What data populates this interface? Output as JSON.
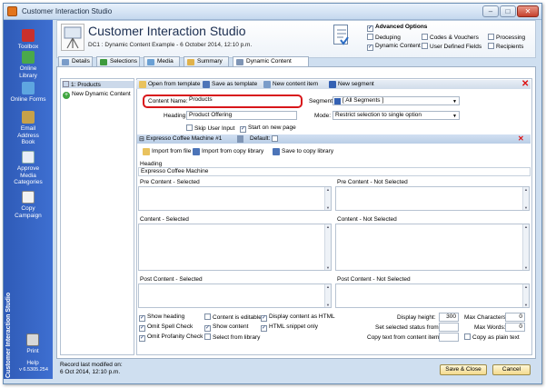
{
  "window": {
    "title": "Customer Interaction Studio",
    "buttons": [
      "–",
      "□",
      "✕"
    ]
  },
  "sidebar": {
    "items": [
      {
        "label": "Toolbox",
        "icon": "toolbox-icon"
      },
      {
        "label": "Online Library",
        "icon": "online-library-icon"
      },
      {
        "label": "Online Forms",
        "icon": "online-forms-icon"
      },
      {
        "label": "Email Address Book",
        "icon": "address-book-icon"
      },
      {
        "label": "Approve Media Categories",
        "icon": "approve-media-icon"
      },
      {
        "label": "Copy Campaign",
        "icon": "copy-campaign-icon"
      },
      {
        "label": "Print",
        "icon": "print-icon"
      },
      {
        "label": "Help",
        "icon": "help-icon"
      }
    ],
    "vertical_label": "Customer Interaction Studio",
    "version": "v 6.5305.254"
  },
  "header": {
    "title": "Customer Interaction Studio",
    "subtitle": "DC1 : Dynamic Content Example - 6 October 2014, 12:10 p.m.",
    "advanced_options_title": "Advanced Options",
    "options": [
      {
        "label": "Deduping",
        "checked": false
      },
      {
        "label": "Codes & Vouchers",
        "checked": false
      },
      {
        "label": "Processing",
        "checked": false
      },
      {
        "label": "Dynamic Content",
        "checked": true
      },
      {
        "label": "User Defined Fields",
        "checked": false
      },
      {
        "label": "Recipients",
        "checked": false
      }
    ]
  },
  "tabs": [
    "Details",
    "Selections",
    "Media",
    "Summary",
    "Dynamic Content"
  ],
  "active_tab": "Dynamic Content",
  "tree": {
    "items": [
      "1: Products",
      "New Dynamic Content"
    ]
  },
  "toolbar": {
    "open_template": "Open from template",
    "save_template": "Save as template",
    "new_content_item": "New content item",
    "new_segment": "New segment"
  },
  "form": {
    "content_name_label": "Content Name:",
    "content_name_value": "Products",
    "heading_label": "Heading:",
    "heading_value": "Product Offering",
    "segment_label": "Segment:",
    "segment_value": "[ All Segments ]",
    "mode_label": "Mode:",
    "mode_value": "Restrict selection to single option",
    "skip_user_input": "Skip User Input",
    "start_on_new_page": "Start on new page"
  },
  "section": {
    "title": "Expresso Coffee Machine #1",
    "default_label": "Default:",
    "import_file": "Import from file",
    "import_library": "Import from copy library",
    "save_library": "Save to copy library",
    "heading_label": "Heading",
    "heading_value": "Expresso Coffee Machine",
    "pre_selected": "Pre Content - Selected",
    "pre_not_selected": "Pre Content - Not Selected",
    "content_selected": "Content - Selected",
    "content_not_selected": "Content - Not Selected",
    "post_selected": "Post Content - Selected",
    "post_not_selected": "Post Content - Not Selected"
  },
  "options_bottom": {
    "show_heading": "Show heading",
    "omit_spell_check": "Omit Spell Check",
    "omit_profanity_check": "Omit Profanity Check",
    "content_is_editable": "Content is editable",
    "show_content": "Show content",
    "select_from_library": "Select from library",
    "display_as_html": "Display content as HTML",
    "html_snippet_only": "HTML snippet only",
    "display_height_label": "Display height:",
    "display_height_value": "300",
    "set_selected_status": "Set selected status from",
    "copy_text_from": "Copy text from content item:",
    "max_characters_label": "Max Characters:",
    "max_characters_value": "0",
    "max_words_label": "Max Words:",
    "max_words_value": "0",
    "copy_as_plain_text": "Copy as plain text"
  },
  "status": {
    "line1": "Record last modifed on:",
    "line2": "6 Oct 2014, 12:10 p.m.",
    "save_close": "Save & Close",
    "cancel": "Cancel"
  },
  "colors": {
    "sidebar": "#3562c4",
    "highlight": "#d8161a",
    "section_header": "#c6d7ec"
  }
}
